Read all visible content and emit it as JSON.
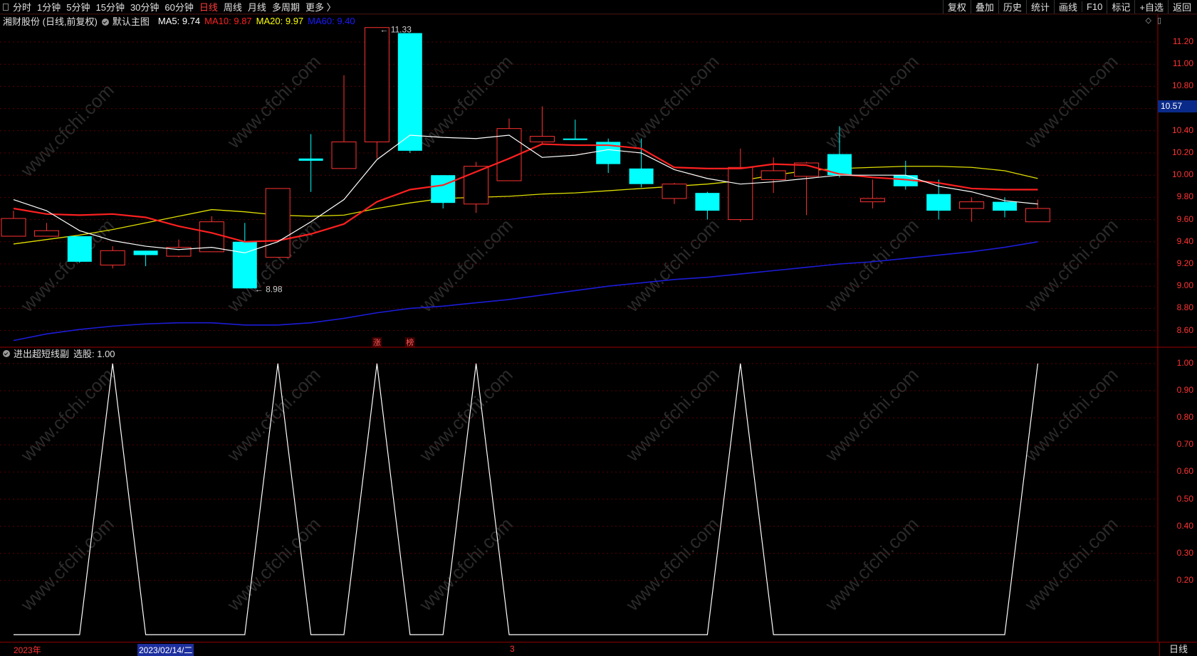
{
  "toolbar": {
    "left_tabs": [
      "分时",
      "1分钟",
      "5分钟",
      "15分钟",
      "30分钟",
      "60分钟",
      "日线",
      "周线",
      "月线",
      "多周期",
      "更多 〉"
    ],
    "active_tab": "日线",
    "right_buttons": [
      "复权",
      "叠加",
      "历史",
      "统计",
      "画线",
      "F10",
      "标记",
      "+自选",
      "返回"
    ]
  },
  "main_chart": {
    "title": "湘财股份 (日线,前复权)",
    "template": "默认主图",
    "ma": [
      {
        "label": "MA5: 9.74",
        "color": "#ffffff"
      },
      {
        "label": "MA10: 9.87",
        "color": "#ff2020"
      },
      {
        "label": "MA20: 9.97",
        "color": "#ffff00"
      },
      {
        "label": "MA60: 9.40",
        "color": "#1a1aff"
      }
    ],
    "price_ticks": [
      "11.20",
      "11.00",
      "10.80",
      "10.60",
      "10.40",
      "10.20",
      "10.00",
      "9.80",
      "9.60",
      "9.40",
      "9.20",
      "9.00",
      "8.80",
      "8.60"
    ],
    "current_price": "10.57",
    "high_label": "11.33",
    "low_label": "8.98",
    "badges": [
      "涨",
      "榜"
    ],
    "colors": {
      "up": "#ff3232",
      "down": "#00ffff",
      "ma5": "#ffffff",
      "ma10": "#ff2020",
      "ma20": "#dede00",
      "ma60": "#1c1cd8",
      "axis": "#ff3333"
    }
  },
  "sub_chart": {
    "title": "进出超短线副",
    "value_label": "选股: 1.00",
    "ticks": [
      "1.00",
      "0.90",
      "0.80",
      "0.70",
      "0.60",
      "0.50",
      "0.40",
      "0.30",
      "0.20"
    ]
  },
  "chart_data": {
    "type": "candlestick",
    "title": "湘财股份 (日线,前复权)",
    "ylim": [
      8.45,
      11.45
    ],
    "candles": [
      {
        "o": 9.45,
        "h": 9.68,
        "l": 9.45,
        "c": 9.61
      },
      {
        "o": 9.45,
        "h": 9.57,
        "l": 9.45,
        "c": 9.5
      },
      {
        "o": 9.45,
        "h": 9.45,
        "l": 9.21,
        "c": 9.22
      },
      {
        "o": 9.19,
        "h": 9.36,
        "l": 9.16,
        "c": 9.32
      },
      {
        "o": 9.32,
        "h": 9.32,
        "l": 9.18,
        "c": 9.28
      },
      {
        "o": 9.27,
        "h": 9.42,
        "l": 9.26,
        "c": 9.35
      },
      {
        "o": 9.31,
        "h": 9.63,
        "l": 9.31,
        "c": 9.58
      },
      {
        "o": 9.4,
        "h": 9.57,
        "l": 8.98,
        "c": 8.98
      },
      {
        "o": 9.26,
        "h": 9.88,
        "l": 9.26,
        "c": 9.88
      },
      {
        "o": 10.15,
        "h": 10.37,
        "l": 9.85,
        "c": 10.13
      },
      {
        "o": 10.06,
        "h": 10.9,
        "l": 10.06,
        "c": 10.3
      },
      {
        "o": 10.3,
        "h": 11.33,
        "l": 10.15,
        "c": 11.33
      },
      {
        "o": 11.28,
        "h": 11.28,
        "l": 10.2,
        "c": 10.22
      },
      {
        "o": 10.0,
        "h": 10.0,
        "l": 9.7,
        "c": 9.75
      },
      {
        "o": 9.74,
        "h": 10.12,
        "l": 9.66,
        "c": 10.08
      },
      {
        "o": 9.95,
        "h": 10.51,
        "l": 9.95,
        "c": 10.42
      },
      {
        "o": 10.3,
        "h": 10.62,
        "l": 10.28,
        "c": 10.35
      },
      {
        "o": 10.33,
        "h": 10.5,
        "l": 10.32,
        "c": 10.32
      },
      {
        "o": 10.3,
        "h": 10.33,
        "l": 10.02,
        "c": 10.1
      },
      {
        "o": 10.06,
        "h": 10.33,
        "l": 9.89,
        "c": 9.92
      },
      {
        "o": 9.79,
        "h": 9.93,
        "l": 9.74,
        "c": 9.92
      },
      {
        "o": 9.84,
        "h": 9.85,
        "l": 9.6,
        "c": 9.68
      },
      {
        "o": 9.6,
        "h": 10.24,
        "l": 9.58,
        "c": 10.07
      },
      {
        "o": 9.96,
        "h": 10.16,
        "l": 9.84,
        "c": 10.04
      },
      {
        "o": 9.99,
        "h": 10.12,
        "l": 9.64,
        "c": 10.11
      },
      {
        "o": 10.19,
        "h": 10.44,
        "l": 9.98,
        "c": 10.0
      },
      {
        "o": 9.76,
        "h": 9.96,
        "l": 9.7,
        "c": 9.79
      },
      {
        "o": 10.0,
        "h": 10.13,
        "l": 9.87,
        "c": 9.9
      },
      {
        "o": 9.83,
        "h": 9.96,
        "l": 9.6,
        "c": 9.68
      },
      {
        "o": 9.7,
        "h": 9.8,
        "l": 9.58,
        "c": 9.76
      },
      {
        "o": 9.76,
        "h": 9.8,
        "l": 9.62,
        "c": 9.68
      },
      {
        "o": 9.58,
        "h": 9.78,
        "l": 9.58,
        "c": 9.7
      }
    ],
    "ma5": [
      9.78,
      9.68,
      9.5,
      9.41,
      9.36,
      9.33,
      9.35,
      9.3,
      9.4,
      9.58,
      9.78,
      10.14,
      10.36,
      10.34,
      10.33,
      10.36,
      10.16,
      10.18,
      10.23,
      10.2,
      10.05,
      9.97,
      9.92,
      9.94,
      9.97,
      10.0,
      10.0,
      10.0,
      9.9,
      9.85,
      9.77,
      9.74
    ],
    "ma10": [
      9.7,
      9.65,
      9.64,
      9.65,
      9.62,
      9.54,
      9.48,
      9.4,
      9.41,
      9.47,
      9.56,
      9.76,
      9.87,
      9.91,
      10.03,
      10.15,
      10.28,
      10.27,
      10.27,
      10.24,
      10.07,
      10.06,
      10.06,
      10.1,
      10.09,
      10.01,
      9.98,
      9.96,
      9.93,
      9.88,
      9.87,
      9.87
    ],
    "ma20": [
      9.38,
      9.42,
      9.46,
      9.51,
      9.57,
      9.63,
      9.69,
      9.67,
      9.64,
      9.63,
      9.64,
      9.7,
      9.75,
      9.79,
      9.8,
      9.81,
      9.83,
      9.84,
      9.86,
      9.88,
      9.9,
      9.92,
      9.95,
      10.0,
      10.04,
      10.06,
      10.07,
      10.08,
      10.08,
      10.07,
      10.04,
      9.97
    ],
    "ma60": [
      8.51,
      8.57,
      8.61,
      8.64,
      8.66,
      8.67,
      8.67,
      8.65,
      8.65,
      8.67,
      8.71,
      8.76,
      8.8,
      8.82,
      8.85,
      8.88,
      8.92,
      8.96,
      9.0,
      9.03,
      9.06,
      9.08,
      9.11,
      9.14,
      9.17,
      9.2,
      9.22,
      9.25,
      9.28,
      9.31,
      9.35,
      9.4
    ],
    "signal": [
      0,
      0,
      0,
      1,
      0,
      0,
      0,
      0,
      1,
      0,
      0,
      1,
      0,
      0,
      1,
      0,
      0,
      0,
      0,
      0,
      0,
      0,
      1,
      0,
      0,
      0,
      0,
      0,
      0,
      0,
      0,
      1
    ],
    "signal_ylim": [
      0,
      1.0
    ]
  },
  "bottom": {
    "year_label": "2023年",
    "cursor_date": "2023/02/14/二",
    "month_label": "3",
    "period": "日线"
  },
  "watermark": "www.cfchi.com"
}
